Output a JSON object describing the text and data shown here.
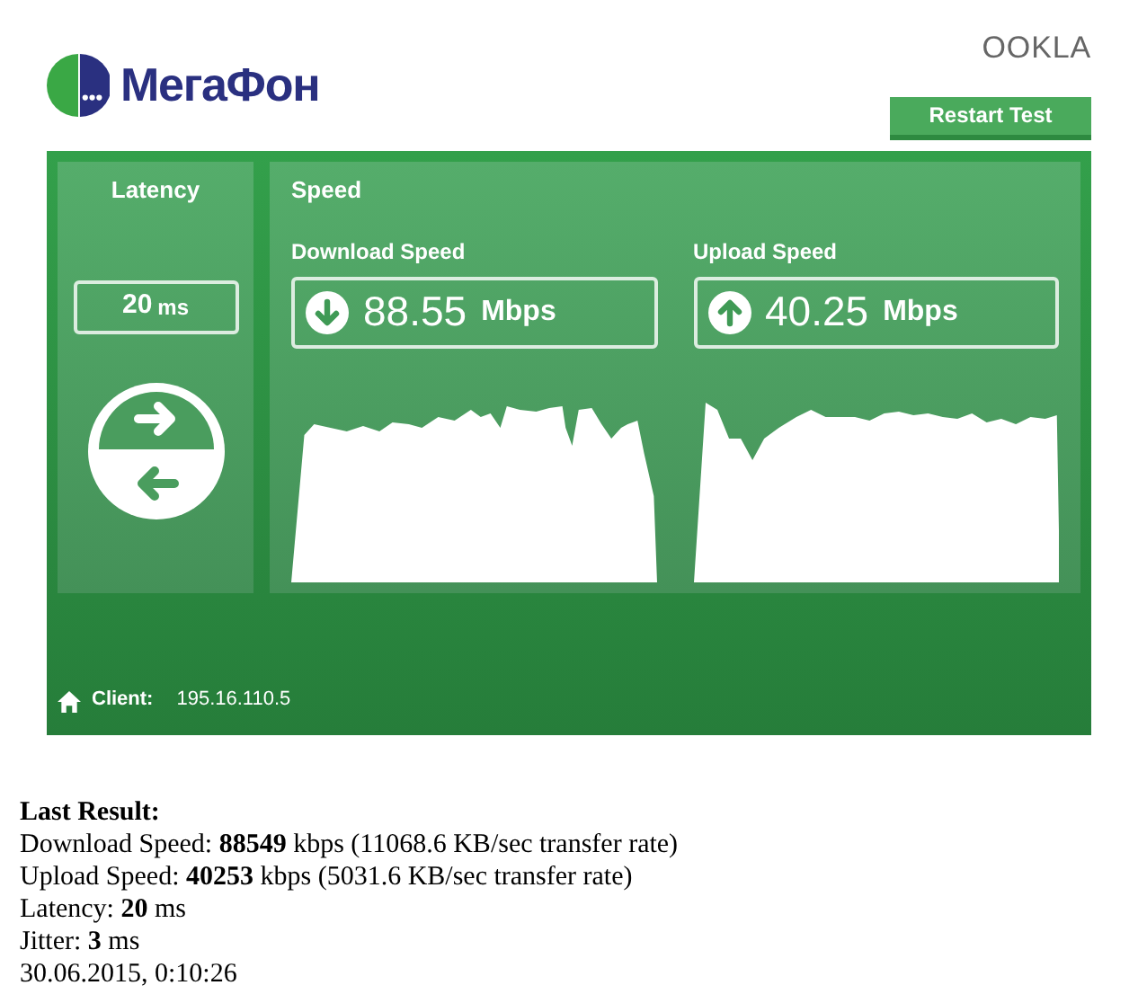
{
  "header": {
    "brand": "МегаФон",
    "partner": "OOKLA",
    "restart_button": "Restart Test"
  },
  "latency": {
    "title": "Latency",
    "value": "20",
    "unit": "ms"
  },
  "speed": {
    "title": "Speed",
    "meters": [
      {
        "kind": "download",
        "label": "Download Speed",
        "value": "88.55",
        "unit": "Mbps"
      },
      {
        "kind": "upload",
        "label": "Upload Speed",
        "value": "40.25",
        "unit": "Mbps"
      }
    ]
  },
  "client": {
    "label": "Client:",
    "ip": "195.16.110.5"
  },
  "last_result": {
    "title": "Last Result:",
    "lines": [
      "Download Speed: **88549** kbps (11068.6 KB/sec transfer rate)",
      "Upload Speed: **40253** kbps (5031.6 KB/sec transfer rate)",
      "Latency: **20** ms",
      "Jitter: **3** ms",
      "30.06.2015, 0:10:26"
    ]
  }
}
